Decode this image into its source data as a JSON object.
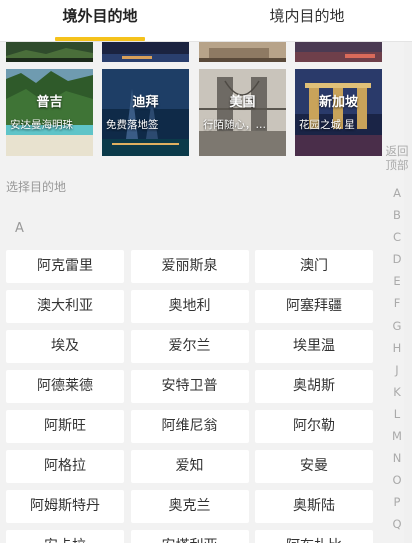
{
  "tabs": [
    {
      "label": "境外目的地",
      "active": true
    },
    {
      "label": "境内目的地",
      "active": false
    }
  ],
  "accent_color": "#f5c21b",
  "featured": [
    {
      "title": "普吉",
      "subtitle": "安达曼海明珠"
    },
    {
      "title": "迪拜",
      "subtitle": "免费落地签"
    },
    {
      "title": "美国",
      "subtitle": "行陌随心，…"
    },
    {
      "title": "新加坡",
      "subtitle": "花园之城 星"
    }
  ],
  "section_label": "选择目的地",
  "letter_heading": "A",
  "countries": [
    "阿克雷里",
    "爱丽斯泉",
    "澳门",
    "澳大利亚",
    "奥地利",
    "阿塞拜疆",
    "埃及",
    "爱尔兰",
    "埃里温",
    "阿德莱德",
    "安特卫普",
    "奥胡斯",
    "阿斯旺",
    "阿维尼翁",
    "阿尔勒",
    "阿格拉",
    "爱知",
    "安曼",
    "阿姆斯特丹",
    "奥克兰",
    "奥斯陆",
    "安卡拉",
    "安塔利亚",
    "阿布扎比"
  ],
  "index": {
    "back_to_top": "返回顶部",
    "letters": [
      "A",
      "B",
      "C",
      "D",
      "E",
      "F",
      "G",
      "H",
      "J",
      "K",
      "L",
      "M",
      "N",
      "O",
      "P",
      "Q"
    ]
  }
}
